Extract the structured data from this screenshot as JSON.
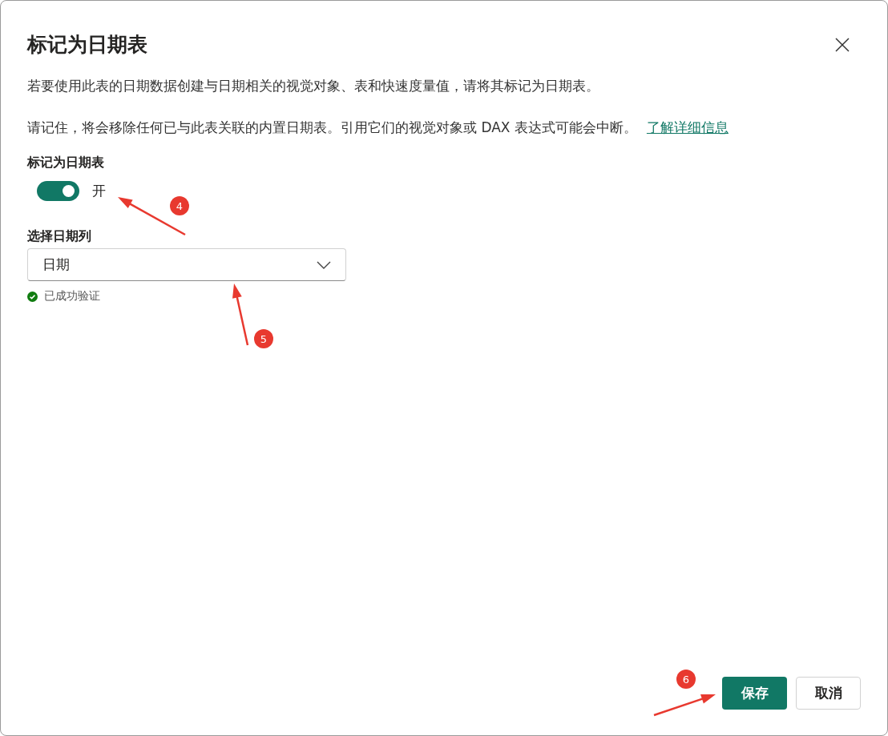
{
  "dialog": {
    "title": "标记为日期表",
    "description": "若要使用此表的日期数据创建与日期相关的视觉对象、表和快速度量值，请将其标记为日期表。",
    "warning": "请记住，将会移除任何已与此表关联的内置日期表。引用它们的视觉对象或 DAX 表达式可能会中断。",
    "link": "了解详细信息"
  },
  "toggle": {
    "label": "标记为日期表",
    "on": true,
    "state_text": "开"
  },
  "date_column": {
    "label": "选择日期列",
    "value": "日期",
    "validation": "已成功验证"
  },
  "buttons": [
    {
      "label": "保存",
      "kind": "primary"
    },
    {
      "label": "取消",
      "kind": "secondary"
    }
  ],
  "annotations": [
    {
      "number": "4"
    },
    {
      "number": "5"
    },
    {
      "number": "6"
    }
  ]
}
